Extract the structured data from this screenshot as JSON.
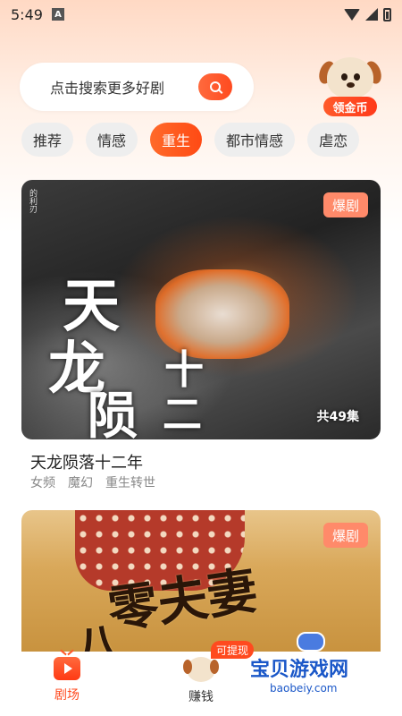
{
  "status_bar": {
    "time": "5:49",
    "notif_letter": "A"
  },
  "search": {
    "placeholder": "点击搜索更多好剧"
  },
  "coin_widget": {
    "label": "领金币"
  },
  "tabs": [
    {
      "label": "推荐",
      "active": false
    },
    {
      "label": "情感",
      "active": false
    },
    {
      "label": "重生",
      "active": true
    },
    {
      "label": "都市情感",
      "active": false
    },
    {
      "label": "虐恋",
      "active": false
    }
  ],
  "cards": [
    {
      "badge": "爆剧",
      "poster_title": "天龙陨十二",
      "episodes": "共49集",
      "side_text": "的利刃",
      "title": "天龙陨落十二年",
      "tags": [
        "女频",
        "魔幻",
        "重生转世"
      ]
    },
    {
      "badge": "爆剧",
      "poster_title": "八零夫妻"
    }
  ],
  "bottom_nav": {
    "theater_label": "剧场",
    "earn_label": "赚钱",
    "withdraw_badge": "可提现"
  },
  "watermark": {
    "text": "宝贝游戏网",
    "url": "baobeiy.com"
  },
  "colors": {
    "accent": "#ff4a1f",
    "badge": "#ff8a6a"
  }
}
